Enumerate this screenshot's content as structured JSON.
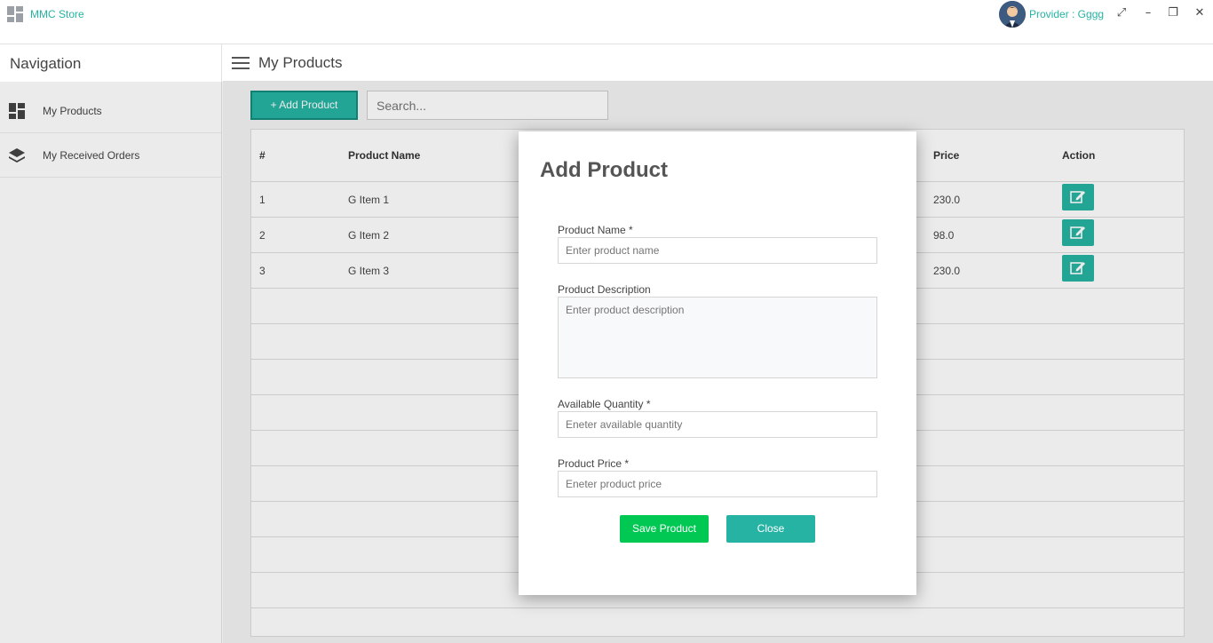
{
  "app": {
    "title": "MMC Store",
    "user_label": "Provider : Gggg"
  },
  "sidebar": {
    "title": "Navigation",
    "items": [
      {
        "label": "My Products",
        "icon": "dashboard-icon"
      },
      {
        "label": "My Received Orders",
        "icon": "layers-icon"
      }
    ]
  },
  "main": {
    "title": "My Products",
    "add_button": "+ Add Product",
    "search_placeholder": "Search..."
  },
  "table": {
    "headers": [
      "#",
      "Product Name",
      "Price",
      "Action"
    ],
    "rows": [
      {
        "num": "1",
        "name": "G Item 1",
        "price": "230.0"
      },
      {
        "num": "2",
        "name": "G Item 2",
        "price": "98.0"
      },
      {
        "num": "3",
        "name": "G Item 3",
        "price": "230.0"
      }
    ]
  },
  "modal": {
    "title": "Add Product",
    "name_label": "Product Name *",
    "name_placeholder": "Enter product name",
    "desc_label": "Product Description",
    "desc_placeholder": "Enter product description",
    "qty_label": "Available Quantity *",
    "qty_placeholder": "Eneter available quantity",
    "price_label": "Product Price *",
    "price_placeholder": "Eneter product price",
    "save_label": "Save Product",
    "close_label": "Close"
  },
  "colors": {
    "accent": "#26b3a3",
    "save": "#00c853"
  }
}
